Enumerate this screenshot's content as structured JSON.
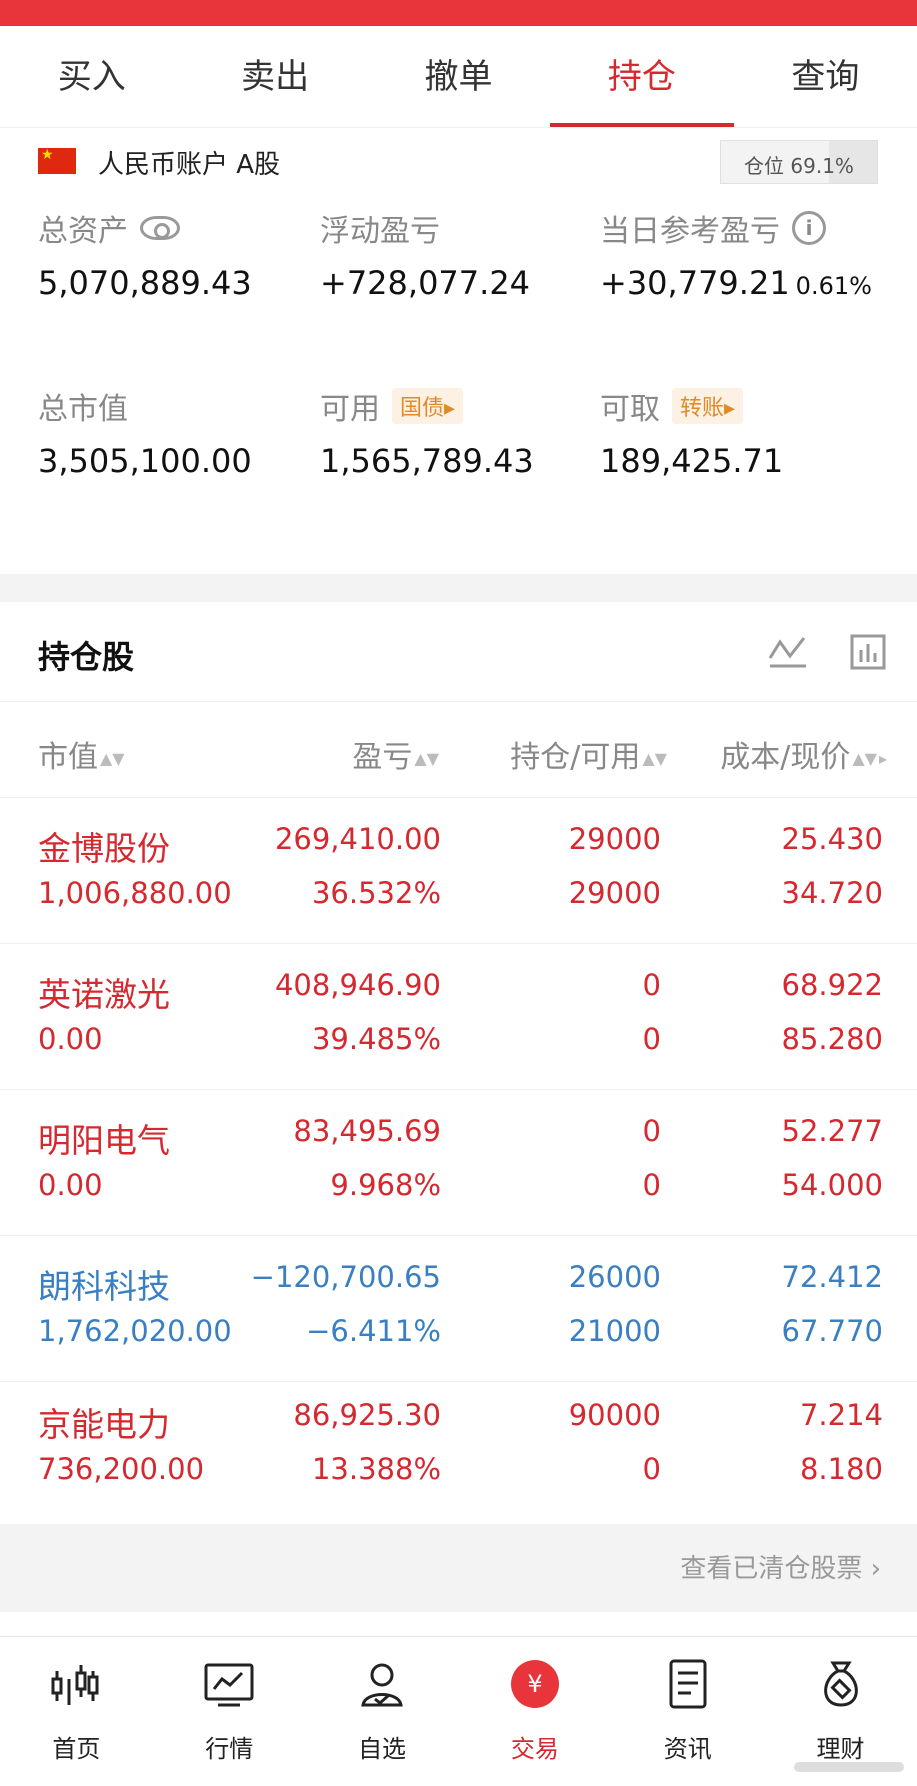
{
  "status_fragment": "",
  "tabs": [
    {
      "label": "买入"
    },
    {
      "label": "卖出"
    },
    {
      "label": "撤单"
    },
    {
      "label": "持仓"
    },
    {
      "label": "查询"
    }
  ],
  "active_tab": "持仓",
  "account": {
    "name": "人民币账户 A股",
    "position_label": "仓位 69.1%",
    "position_ratio": 0.691
  },
  "summary": {
    "total_assets": {
      "label": "总资产",
      "value": "5,070,889.43"
    },
    "floating_pl": {
      "label": "浮动盈亏",
      "value": "+728,077.24"
    },
    "daily_pl": {
      "label": "当日参考盈亏",
      "value": "+30,779.21",
      "pct": "0.61%"
    },
    "market_value": {
      "label": "总市值",
      "value": "3,505,100.00"
    },
    "available": {
      "label": "可用",
      "chip": "国债",
      "value": "1,565,789.43"
    },
    "withdrawable": {
      "label": "可取",
      "chip": "转账",
      "value": "189,425.71"
    }
  },
  "holdings": {
    "title": "持仓股",
    "columns": {
      "market_value": "市值",
      "pl": "盈亏",
      "position": "持仓/可用",
      "cost": "成本/现价"
    },
    "rows": [
      {
        "name": "金博股份",
        "market_value": "1,006,880.00",
        "pl": "269,410.00",
        "pl_pct": "36.532%",
        "hold": "29000",
        "avail": "29000",
        "cost": "25.430",
        "price": "34.720",
        "tone": "red"
      },
      {
        "name": "英诺激光",
        "market_value": "0.00",
        "pl": "408,946.90",
        "pl_pct": "39.485%",
        "hold": "0",
        "avail": "0",
        "cost": "68.922",
        "price": "85.280",
        "tone": "red"
      },
      {
        "name": "明阳电气",
        "market_value": "0.00",
        "pl": "83,495.69",
        "pl_pct": "9.968%",
        "hold": "0",
        "avail": "0",
        "cost": "52.277",
        "price": "54.000",
        "tone": "red"
      },
      {
        "name": "朗科科技",
        "market_value": "1,762,020.00",
        "pl": "−120,700.65",
        "pl_pct": "−6.411%",
        "hold": "26000",
        "avail": "21000",
        "cost": "72.412",
        "price": "67.770",
        "tone": "blue"
      },
      {
        "name": "京能电力",
        "market_value": "736,200.00",
        "pl": "86,925.30",
        "pl_pct": "13.388%",
        "hold": "90000",
        "avail": "0",
        "cost": "7.214",
        "price": "8.180",
        "tone": "red"
      }
    ],
    "view_cleared": "查看已清仓股票"
  },
  "bottom_nav": [
    {
      "label": "首页",
      "icon": "candlestick-icon"
    },
    {
      "label": "行情",
      "icon": "chart-monitor-icon"
    },
    {
      "label": "自选",
      "icon": "person-check-icon"
    },
    {
      "label": "交易",
      "icon": "yuan-coin-icon"
    },
    {
      "label": "资讯",
      "icon": "document-icon"
    },
    {
      "label": "理财",
      "icon": "money-bag-icon"
    }
  ],
  "colors": {
    "accent": "#d6282f",
    "loss": "#3a7fc2",
    "chip": "#e08a2a"
  }
}
